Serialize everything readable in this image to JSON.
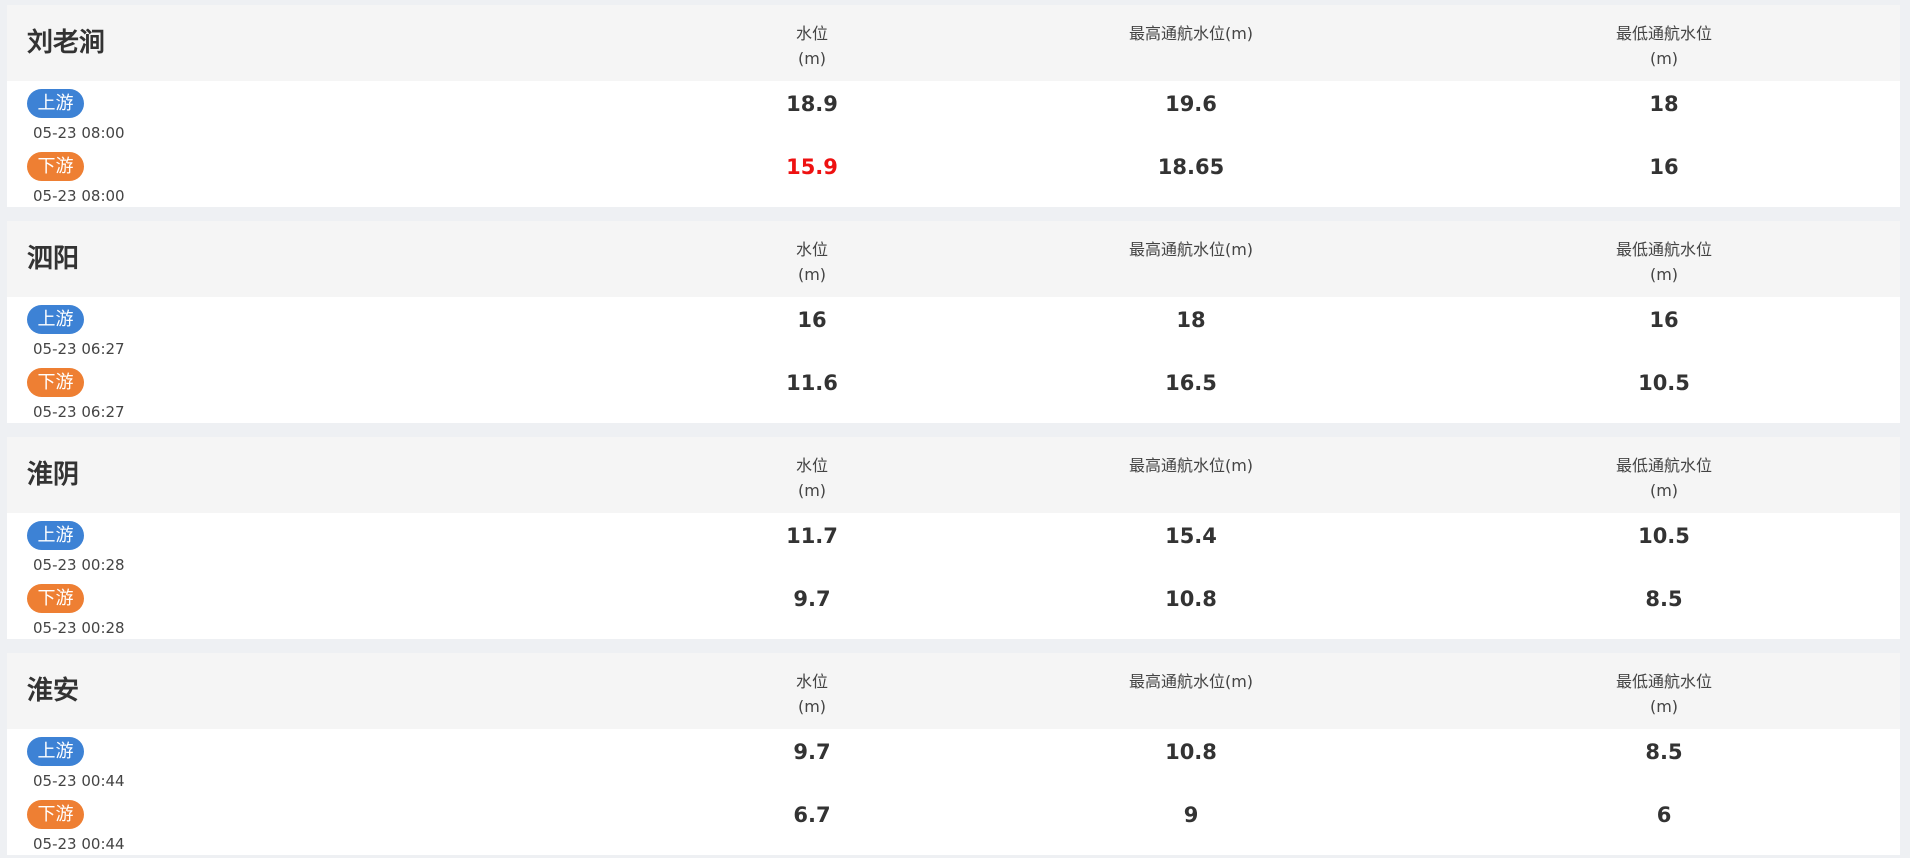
{
  "columns": {
    "level_line1": "水位",
    "level_line2": "(m)",
    "max_nav": "最高通航水位(m)",
    "min_nav_line1": "最低通航水位",
    "min_nav_line2": "(m)"
  },
  "directions": {
    "upstream": "上游",
    "downstream": "下游"
  },
  "colors": {
    "upstream_badge": "#3d82d5",
    "downstream_badge": "#ee7f33",
    "alert_value": "#ee1111"
  },
  "stations": [
    {
      "name": "刘老涧",
      "upstream": {
        "time": "05-23 08:00",
        "level": "18.9",
        "max_nav": "19.6",
        "min_nav": "18"
      },
      "downstream": {
        "time": "05-23 08:00",
        "level": "15.9",
        "max_nav": "18.65",
        "min_nav": "16"
      }
    },
    {
      "name": "泗阳",
      "upstream": {
        "time": "05-23 06:27",
        "level": "16",
        "max_nav": "18",
        "min_nav": "16"
      },
      "downstream": {
        "time": "05-23 06:27",
        "level": "11.6",
        "max_nav": "16.5",
        "min_nav": "10.5"
      }
    },
    {
      "name": "淮阴",
      "upstream": {
        "time": "05-23 00:28",
        "level": "11.7",
        "max_nav": "15.4",
        "min_nav": "10.5"
      },
      "downstream": {
        "time": "05-23 00:28",
        "level": "9.7",
        "max_nav": "10.8",
        "min_nav": "8.5"
      }
    },
    {
      "name": "淮安",
      "upstream": {
        "time": "05-23 00:44",
        "level": "9.7",
        "max_nav": "10.8",
        "min_nav": "8.5"
      },
      "downstream": {
        "time": "05-23 00:44",
        "level": "6.7",
        "max_nav": "9",
        "min_nav": "6"
      }
    }
  ]
}
